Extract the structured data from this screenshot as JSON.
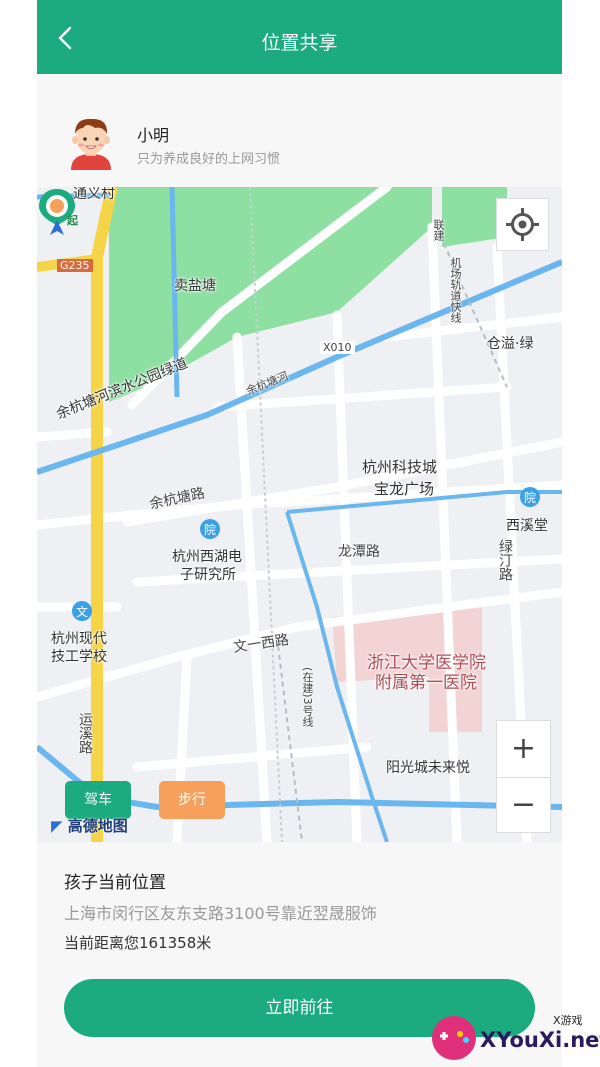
{
  "header": {
    "title": "位置共享",
    "back_icon": "chevron-left-icon"
  },
  "user": {
    "name": "小明",
    "motto": "只为养成良好的上网习惯"
  },
  "map": {
    "labels": {
      "tongyi": "通义村",
      "g235": "G235",
      "maiyantang": "卖盐塘",
      "x010": "X010",
      "lianjie": "联建",
      "jichang": "机场轨道快线",
      "yuhangtanghe": "余杭塘河",
      "binshui": "余杭塘河滨水公园绿道",
      "cangyi": "仓溢·绿",
      "keji": "杭州科技城",
      "baolong": "宝龙广场",
      "yuhangtanglu": "余杭塘路",
      "xiqitang": "西溪堂",
      "lvting": "绿汀路",
      "xihu_dianzi_1": "杭州西湖电",
      "xihu_dianzi_2": "子研究所",
      "longtan": "龙潭路",
      "xiandai_1": "杭州现代",
      "xiandai_2": "技工学校",
      "wenyi": "文一西路",
      "zheda_1": "浙江大学医学院",
      "zheda_2": "附属第一医院",
      "yunxi": "运溪路",
      "yangguang": "阳光城未来悦",
      "jianshe": "(在建)3号线",
      "meng": "蒙",
      "start_marker": "起"
    },
    "zoom_in": "+",
    "zoom_out": "−",
    "mode_drive": "驾车",
    "mode_walk": "步行",
    "logo": "高德地图"
  },
  "info": {
    "title": "孩子当前位置",
    "address": "上海市闵行区友东支路3100号靠近翌晟服饰",
    "distance": "当前距离您161358米"
  },
  "action": {
    "go_label": "立即前往"
  },
  "watermark": {
    "text": "XYouXi.net",
    "small": "X游戏"
  },
  "colors": {
    "primary": "#1bab7f",
    "walk": "#f7a05c",
    "park": "#8edfa2",
    "hospital": "#f2d4d5"
  }
}
